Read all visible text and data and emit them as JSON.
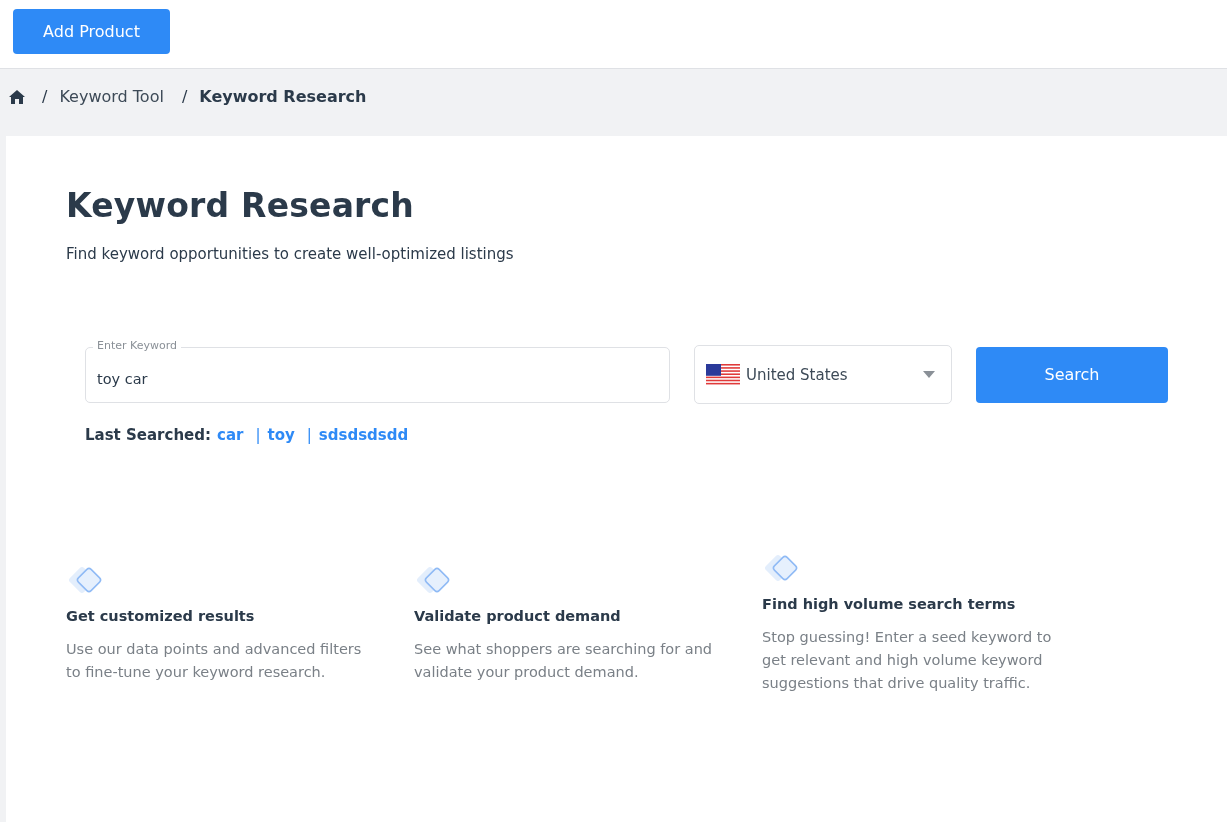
{
  "top_bar": {
    "add_button": "Add Product"
  },
  "breadcrumb": {
    "separator": "/",
    "items": [
      "Keyword Tool",
      "Keyword Research"
    ]
  },
  "header": {
    "title": "Keyword Research",
    "subtitle": "Find keyword opportunities to create well-optimized listings"
  },
  "search": {
    "keyword_field": {
      "label": "Enter Keyword",
      "value": "toy car"
    },
    "country": "United States",
    "button": "Search"
  },
  "last_searched": {
    "label": "Last Searched:",
    "separator": "|",
    "items": [
      "car",
      "toy",
      "sdsdsdsdd"
    ]
  },
  "features": [
    {
      "title": "Get customized results",
      "text": "Use our data points and advanced filters to fine-tune your keyword research."
    },
    {
      "title": "Validate product demand",
      "text": "See what shoppers are searching for and validate your product demand."
    },
    {
      "title": "Find high volume search terms",
      "text": "Stop guessing! Enter a seed keyword to get relevant and high volume keyword suggestions that drive quality traffic."
    }
  ]
}
